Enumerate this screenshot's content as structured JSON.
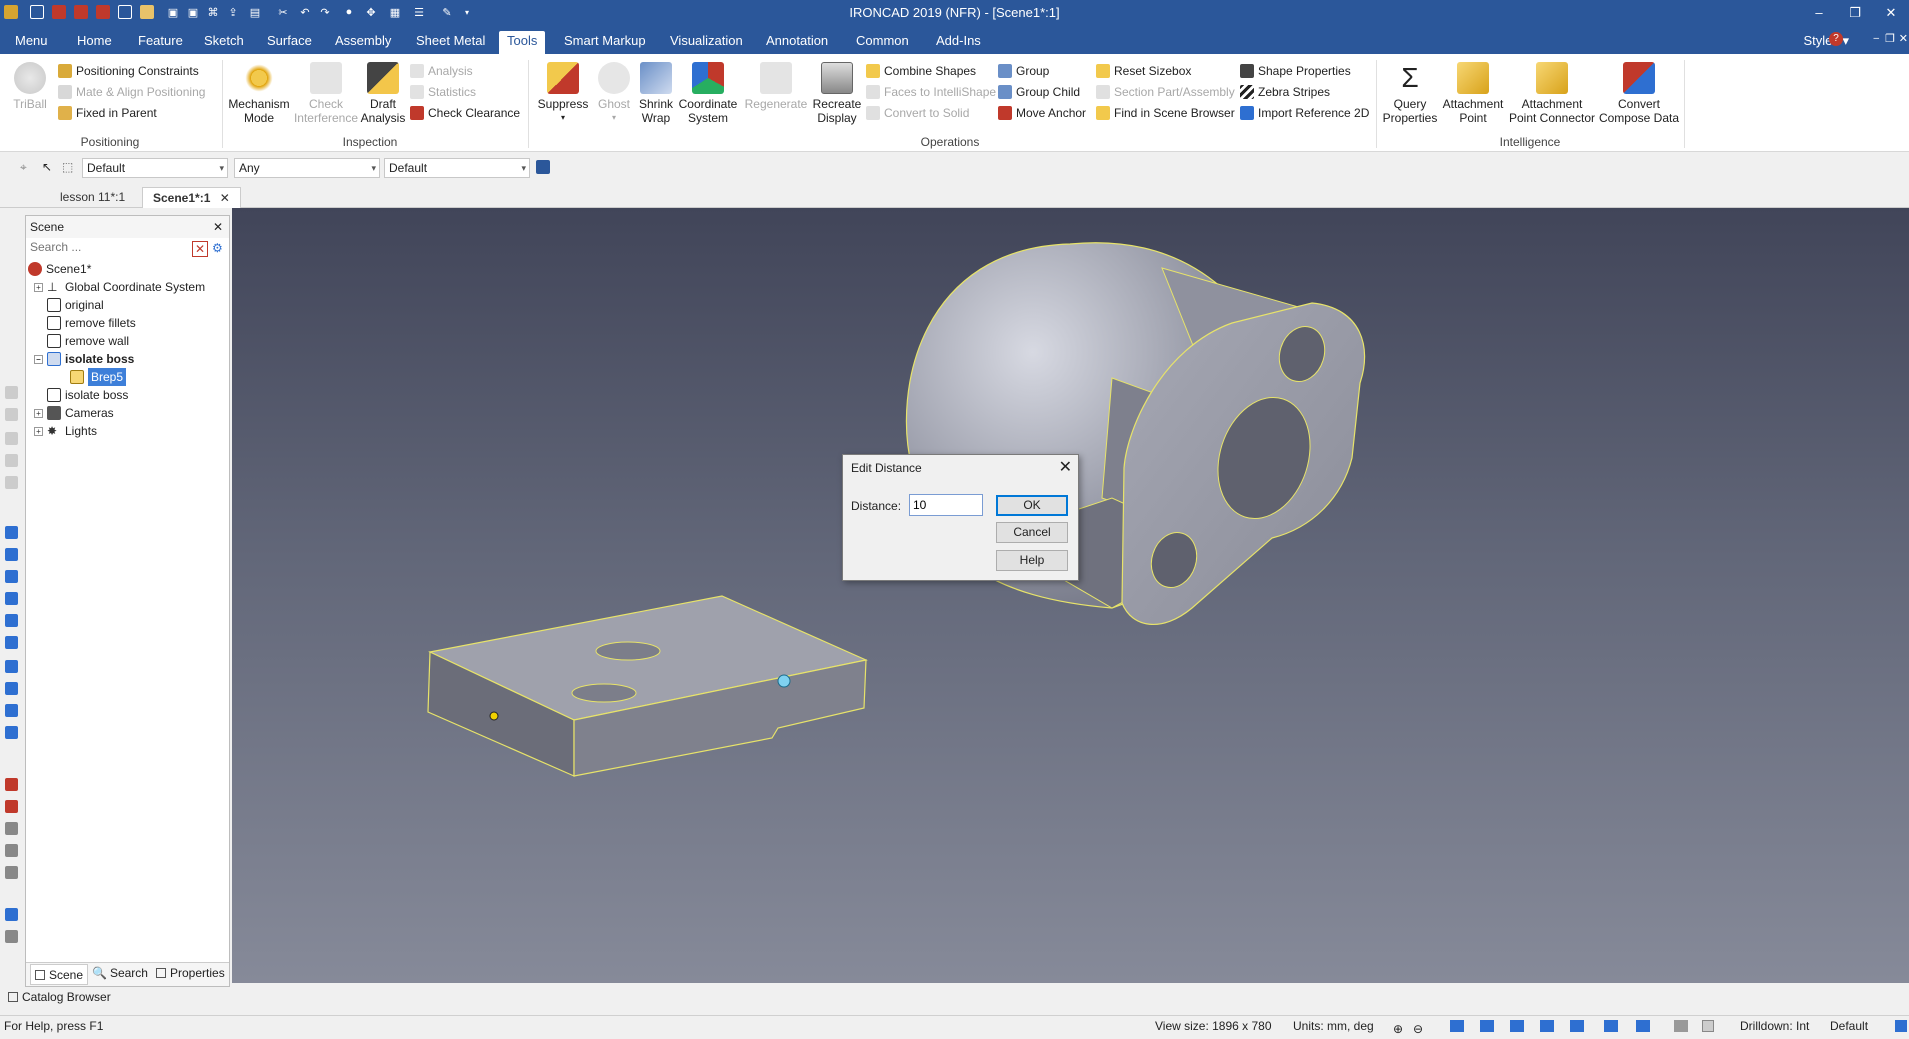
{
  "window": {
    "title": "IRONCAD 2019 (NFR) - [Scene1*:1]",
    "minimize": "–",
    "restore": "❐",
    "close": "✕"
  },
  "ribbon_tabs": [
    "Menu",
    "Home",
    "Feature",
    "Sketch",
    "Surface",
    "Assembly",
    "Sheet Metal",
    "Tools",
    "Smart Markup",
    "Visualization",
    "Annotation",
    "Common",
    "Add-Ins"
  ],
  "active_tab": "Tools",
  "styles_label": "Styles",
  "ribbon": {
    "positioning": {
      "label": "Positioning",
      "triball": "TriBall",
      "positioning_constraints": "Positioning Constraints",
      "mate_align": "Mate & Align Positioning",
      "fixed_in_parent": "Fixed in Parent"
    },
    "inspection": {
      "label": "Inspection",
      "mechanism_mode_1": "Mechanism",
      "mechanism_mode_2": "Mode",
      "check_interference_1": "Check",
      "check_interference_2": "Interference",
      "draft_analysis_1": "Draft",
      "draft_analysis_2": "Analysis",
      "analysis": "Analysis",
      "statistics": "Statistics",
      "check_clearance": "Check Clearance"
    },
    "operations": {
      "label": "Operations",
      "suppress": "Suppress",
      "ghost": "Ghost",
      "shrink_wrap_1": "Shrink",
      "shrink_wrap_2": "Wrap",
      "coordinate_system_1": "Coordinate",
      "coordinate_system_2": "System",
      "regenerate": "Regenerate",
      "recreate_display_1": "Recreate",
      "recreate_display_2": "Display",
      "combine_shapes": "Combine Shapes",
      "faces_to_intellishape": "Faces to IntelliShape",
      "convert_to_solid": "Convert to Solid",
      "group": "Group",
      "group_child": "Group Child",
      "move_anchor": "Move Anchor",
      "reset_sizebox": "Reset Sizebox",
      "section_part": "Section Part/Assembly",
      "find_in_scene": "Find in Scene Browser",
      "shape_properties": "Shape Properties",
      "zebra_stripes": "Zebra Stripes",
      "import_reference": "Import Reference 2D"
    },
    "intelligence": {
      "label": "Intelligence",
      "query_properties_1": "Query",
      "query_properties_2": "Properties",
      "attachment_point_1": "Attachment",
      "attachment_point_2": "Point",
      "attachment_connector_1": "Attachment",
      "attachment_connector_2": "Point Connector",
      "convert_compose_1": "Convert",
      "convert_compose_2": "Compose Data"
    }
  },
  "toolbar": {
    "combo1": "Default",
    "combo2": "Any",
    "combo3": "Default"
  },
  "doc_tabs": [
    "lesson 11*:1",
    "Scene1*:1"
  ],
  "scene_panel": {
    "title": "Scene",
    "search_placeholder": "Search ...",
    "tree": [
      {
        "label": "Scene1*",
        "bold": false
      },
      {
        "label": "Global Coordinate System"
      },
      {
        "label": "original"
      },
      {
        "label": "remove fillets"
      },
      {
        "label": "remove wall"
      },
      {
        "label": "isolate boss"
      },
      {
        "label": "Brep5"
      },
      {
        "label": "isolate boss"
      },
      {
        "label": "Cameras"
      },
      {
        "label": "Lights"
      }
    ],
    "tabs": [
      "Scene",
      "Search",
      "Properties"
    ]
  },
  "dialog": {
    "title": "Edit Distance",
    "distance_label": "Distance:",
    "distance_value": "10",
    "ok": "OK",
    "cancel": "Cancel",
    "help": "Help"
  },
  "catalog_browser": "Catalog Browser",
  "status": {
    "help": "For Help, press F1",
    "view_size": "View size: 1896 x  780",
    "units": "Units: mm, deg",
    "drilldown": "Drilldown: Int",
    "style": "Default"
  },
  "colors": {
    "title_bg": "#2b579a",
    "accent": "#0078d7",
    "edge_highlight": "#e7e36a"
  }
}
